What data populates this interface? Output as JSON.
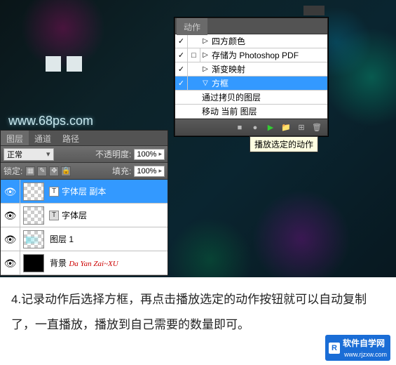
{
  "watermark": "www.68ps.com",
  "actions": {
    "tab": "动作",
    "rows": [
      {
        "check": "✓",
        "mode": "",
        "arrow": "▷",
        "label": "四方颜色",
        "sel": false,
        "nested": false
      },
      {
        "check": "✓",
        "mode": "□",
        "arrow": "▷",
        "label": "存储为 Photoshop PDF",
        "sel": false,
        "nested": false
      },
      {
        "check": "✓",
        "mode": "",
        "arrow": "▷",
        "label": "渐变映射",
        "sel": false,
        "nested": false
      },
      {
        "check": "✓",
        "mode": "",
        "arrow": "▽",
        "label": "方框",
        "sel": true,
        "nested": false
      },
      {
        "check": "",
        "mode": "",
        "arrow": "",
        "label": "通过拷贝的图层",
        "sel": false,
        "nested": true
      },
      {
        "check": "",
        "mode": "",
        "arrow": "",
        "label": "移动 当前 图层",
        "sel": false,
        "nested": true
      }
    ],
    "tooltip": "播放选定的动作",
    "footer": {
      "stop": "■",
      "rec": "●",
      "play": "▶",
      "folder": "📁",
      "new": "⊞",
      "trash": "🗑"
    }
  },
  "layers": {
    "tabs": {
      "layers": "图层",
      "channels": "通道",
      "paths": "路径"
    },
    "blend_label": "正常",
    "opacity_label": "不透明度:",
    "opacity_value": "100%",
    "lock_label": "锁定:",
    "fill_label": "填充:",
    "fill_value": "100%",
    "rows": [
      {
        "name": "字体层 副本",
        "sel": true,
        "thumb": "checker",
        "type": "T"
      },
      {
        "name": "字体层",
        "sel": false,
        "thumb": "checker",
        "type": "T"
      },
      {
        "name": "图层 1",
        "sel": false,
        "thumb": "aqua",
        "type": ""
      },
      {
        "name": "背景",
        "sel": false,
        "thumb": "black",
        "type": "",
        "sig": "Da Yan Zai~XU"
      }
    ]
  },
  "caption": "4.记录动作后选择方框，再点击播放选定的动作按钮就可以自动复制了，一直播放，播放到自己需要的数量即可。",
  "logo": {
    "brand": "软件自学网",
    "url": "www.rjzxw.com",
    "mark": "R"
  }
}
